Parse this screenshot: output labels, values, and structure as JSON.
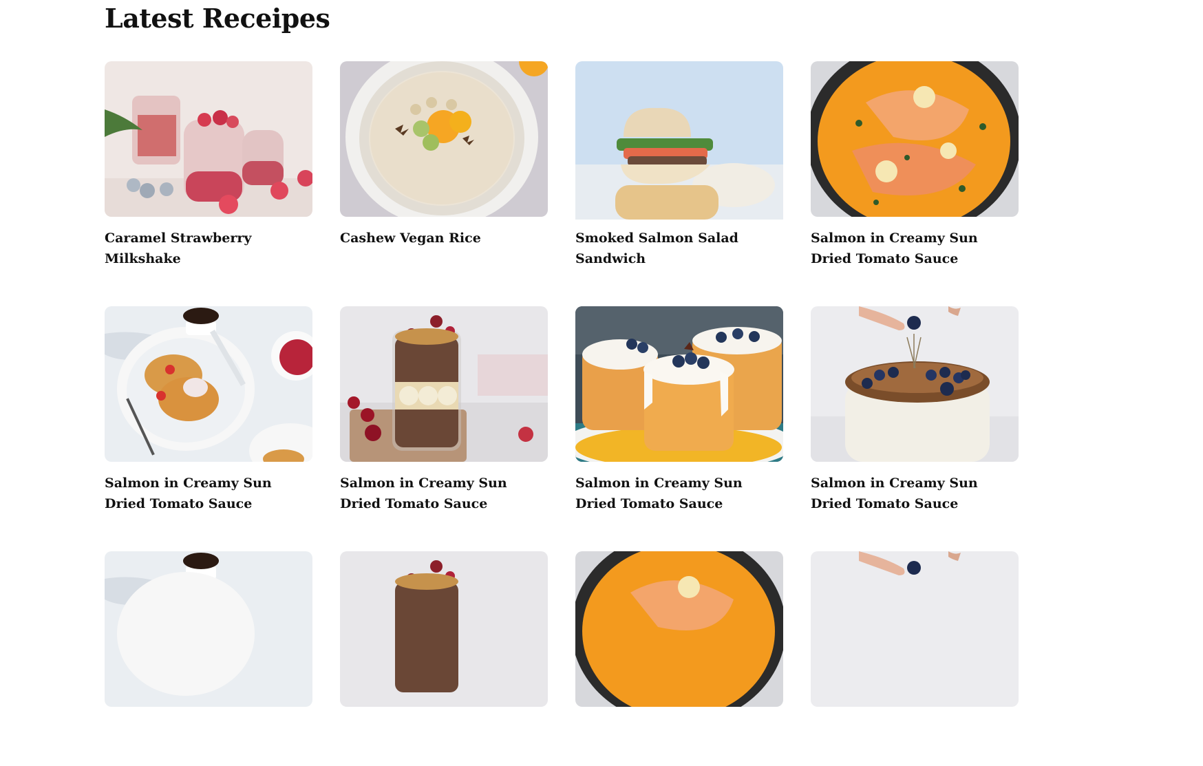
{
  "section": {
    "title": "Latest Receipes"
  },
  "recipes": [
    {
      "title": "Caramel Strawberry Milkshake",
      "image": "strawberry-milkshake-photo",
      "bg": "#efe6e3"
    },
    {
      "title": "Cashew Vegan Rice",
      "image": "oatmeal-bowl-photo",
      "bg": "#cfcdd3"
    },
    {
      "title": "Smoked Salmon Salad Sandwich",
      "image": "salmon-sandwich-photo",
      "bg": "#cfdff0"
    },
    {
      "title": "Salmon in Creamy Sun Dried Tomato Sauce",
      "image": "salmon-pan-photo",
      "bg": "#2a2a2a"
    },
    {
      "title": "Salmon in Creamy Sun Dried Tomato Sauce",
      "image": "pancakes-photo",
      "bg": "#e9eef3"
    },
    {
      "title": "Salmon in Creamy Sun Dried Tomato Sauce",
      "image": "chocolate-jar-photo",
      "bg": "#e8e6e8"
    },
    {
      "title": "Salmon in Creamy Sun Dried Tomato Sauce",
      "image": "frosted-cakes-photo",
      "bg": "#3b4a55"
    },
    {
      "title": "Salmon in Creamy Sun Dried Tomato Sauce",
      "image": "blueberry-cake-photo",
      "bg": "#ebebee"
    },
    {
      "title": "",
      "image": "pancakes-photo",
      "bg": "#e9eef3"
    },
    {
      "title": "",
      "image": "chocolate-jar-photo",
      "bg": "#e8e6e8"
    },
    {
      "title": "",
      "image": "salmon-pan-photo",
      "bg": "#2a2a2a"
    },
    {
      "title": "",
      "image": "blueberry-cake-photo",
      "bg": "#ebebee"
    }
  ]
}
